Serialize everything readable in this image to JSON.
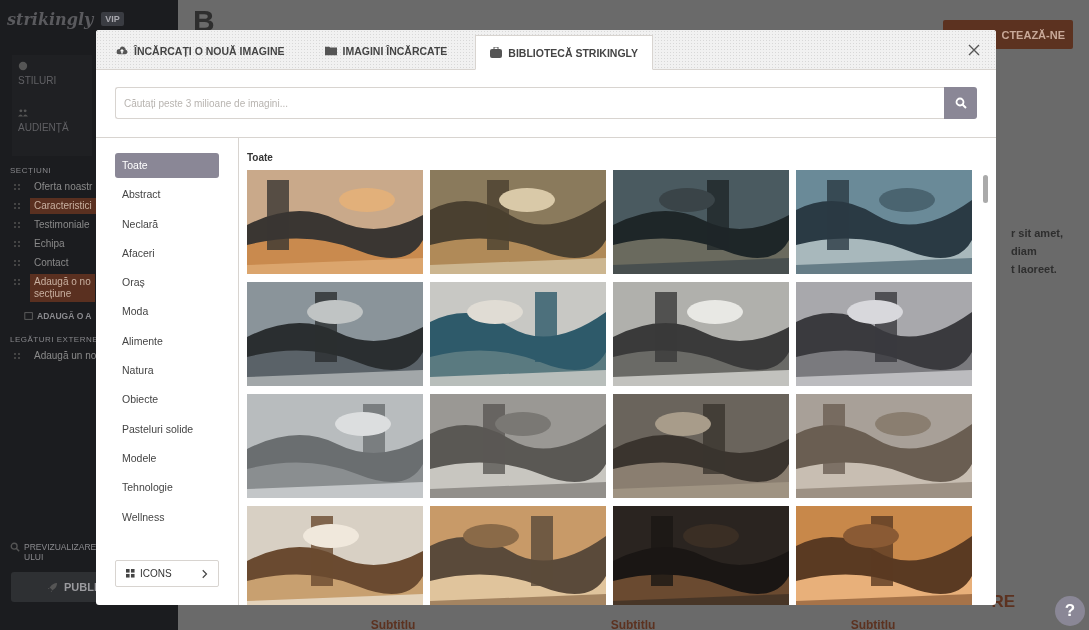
{
  "sidebar": {
    "logo": "strikingly",
    "badge": "VIP",
    "panels": [
      {
        "label": "STILURI",
        "kind": "styles"
      },
      {
        "label": "AUDIENȚĂ",
        "kind": "audience"
      }
    ],
    "sections_heading": "SECȚIUNI",
    "sections": [
      {
        "lines": [
          "Oferta noastr"
        ],
        "selected": false
      },
      {
        "lines": [
          "Caracteristici"
        ],
        "selected": true
      },
      {
        "lines": [
          "Testimoniale"
        ],
        "selected": false
      },
      {
        "lines": [
          "Echipa"
        ],
        "selected": false
      },
      {
        "lines": [
          "Contact"
        ],
        "selected": false
      },
      {
        "lines": [
          "Adaugă o no",
          "secțiune"
        ],
        "selected": true
      }
    ],
    "add_button": "ADAUGĂ O A",
    "external_heading": "LEGĂTURI EXTERNE",
    "external_item": "Adaugă un no",
    "preview_lines": [
      "PREVIZUALIZARE",
      "ULUI"
    ],
    "publish": "PUBLI"
  },
  "page": {
    "title_fragment": "B",
    "contact_button": "CTEAZĂ-NE",
    "paragraph_lines": [
      "r sit amet,",
      "diam",
      "t laoreet."
    ],
    "heading_fragment": "RE",
    "subtitles": [
      "Subtitlu",
      "Subtitlu",
      "Subtitlu"
    ],
    "help": "?"
  },
  "modal": {
    "tabs": [
      {
        "label": "ÎNCĂRCAȚI O NOUĂ IMAGINE",
        "kind": "upload",
        "selected": false
      },
      {
        "label": "IMAGINI ÎNCĂRCATE",
        "kind": "folder",
        "selected": false
      },
      {
        "label": "BIBLIOTECĂ STRIKINGLY",
        "kind": "library",
        "selected": true
      }
    ],
    "search": {
      "placeholder": "Căutați peste 3 milioane de imagini..."
    },
    "categories": [
      {
        "label": "Toate",
        "selected": true
      },
      {
        "label": "Abstract",
        "selected": false
      },
      {
        "label": "Neclară",
        "selected": false
      },
      {
        "label": "Afaceri",
        "selected": false
      },
      {
        "label": "Oraș",
        "selected": false
      },
      {
        "label": "Moda",
        "selected": false
      },
      {
        "label": "Alimente",
        "selected": false
      },
      {
        "label": "Natura",
        "selected": false
      },
      {
        "label": "Obiecte",
        "selected": false
      },
      {
        "label": "Pasteluri solide",
        "selected": false
      },
      {
        "label": "Modele",
        "selected": false
      },
      {
        "label": "Tehnologie",
        "selected": false
      },
      {
        "label": "Wellness",
        "selected": false
      }
    ],
    "icons_button": "ICONS",
    "gallery_heading": "Toate"
  }
}
